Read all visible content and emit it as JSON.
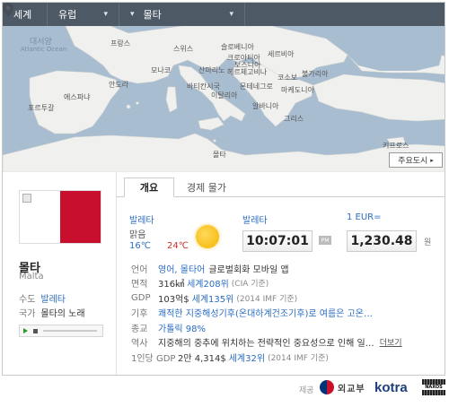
{
  "nav": {
    "seg1": "세계",
    "seg2": "유럽",
    "seg3": "몰타"
  },
  "map": {
    "labels": {
      "atlantic_kr": "대서양",
      "atlantic_en": "Atlantic Ocean",
      "france": "프랑스",
      "switzerland": "스위스",
      "slovenia": "슬로베니아",
      "croatia": "크로아티아",
      "serbia": "세르비아",
      "monaco": "모나코",
      "sanmarino": "산마리노",
      "bosnia1": "보스니아",
      "bosnia2": "헤르체고비나",
      "kosovo": "코소보",
      "bulgaria": "불가리아",
      "andorra": "안도라",
      "vatican": "바티칸시국",
      "montenegro": "몬테네그로",
      "macedonia": "마케도니아",
      "spain": "에스파냐",
      "italy": "이탈리아",
      "albania": "알바니아",
      "portugal": "포르투갈",
      "greece": "그리스",
      "malta": "몰타",
      "cyprus": "키프로스"
    },
    "main_cities_label": "주요도시"
  },
  "country": {
    "name": "몰타",
    "name_en": "Malta",
    "capital_key": "수도",
    "capital": "발레타",
    "anthem_key": "국가",
    "anthem": "몰타의 노래"
  },
  "tabs": {
    "overview": "개요",
    "prices": "경제 물가"
  },
  "weather": {
    "city": "발레타",
    "condition": "맑음",
    "low": "16℃",
    "high": "24℃"
  },
  "clock": {
    "city": "발레타",
    "time": "10:07:01",
    "badge": "PM"
  },
  "fx": {
    "label": "1 EUR=",
    "value": "1,230.48",
    "unit": "원"
  },
  "facts": {
    "language": {
      "key": "언어",
      "value": "영어, 몰타어",
      "extra": "글로벌회화 모바일 앱"
    },
    "area": {
      "key": "면적",
      "value": "316㎢",
      "rank": "세계208위",
      "note": "(CIA 기준)"
    },
    "gdp": {
      "key": "GDP",
      "value": "103억$",
      "rank": "세계135위",
      "note": "(2014 IMF 기준)"
    },
    "climate": {
      "key": "기후",
      "value": "쾌적한 지중해성기후(온대하계건조기후)로 여름은 고온…"
    },
    "religion": {
      "key": "종교",
      "value": "가톨릭 98%"
    },
    "history": {
      "key": "역사",
      "value": "지중해의 중추에 위치하는 전략적인 중요성으로 인해 일…",
      "more": "더보기"
    },
    "gdp_per_capita": {
      "key": "1인당 GDP",
      "value": "2만 4,314$",
      "rank": "세계32위",
      "note": "(2014 IMF 기준)"
    }
  },
  "footer": {
    "provided": "제공",
    "mofa": "외교부",
    "kotra": "kotra",
    "naxos": "NAXOS"
  }
}
